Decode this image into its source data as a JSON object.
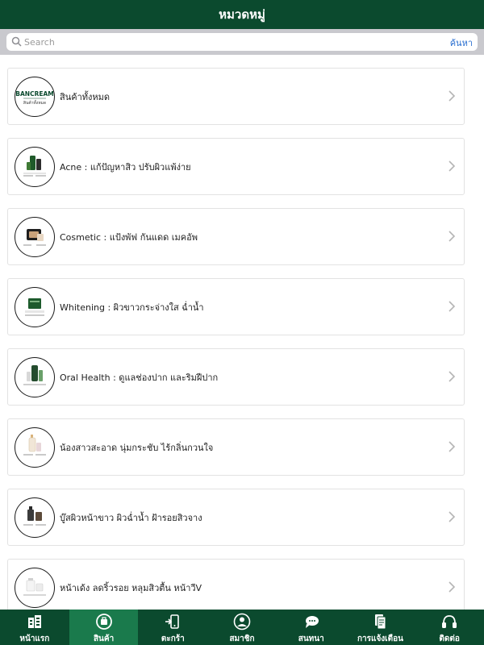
{
  "header": {
    "title": "หมวดหมู่"
  },
  "search": {
    "placeholder": "Search",
    "button_label": "ค้นหา"
  },
  "categories": [
    {
      "label": "สินค้าทั้งหมด",
      "thumb_text": "BANCREAM",
      "thumb_subtext": "สินค้าทั้งหมด",
      "icon": "brand-logo"
    },
    {
      "label": "Acne : แก้ปัญหาสิว ปรับผิวแพ้ง่าย",
      "icon": "acne-products"
    },
    {
      "label": "Cosmetic : แป้งพัฟ กันแดด เมคอัพ",
      "icon": "cosmetic-products"
    },
    {
      "label": "Whitening : ผิวขาวกระจ่างใส ฉ่ำน้ำ",
      "icon": "whitening-products"
    },
    {
      "label": "Oral Health : ดูแลช่องปาก และริมฝีปาก",
      "icon": "oral-health-products"
    },
    {
      "label": "น้องสาวสะอาด นุ่มกระชับ ไร้กลิ่นกวนใจ",
      "icon": "feminine-care-products"
    },
    {
      "label": "บู๊สผิวหน้าขาว ผิวฉ่ำน้ำ ฝ้ารอยสิวจาง",
      "icon": "face-booster-products"
    },
    {
      "label": "หน้าเด้ง ลดริ้วรอย หลุมสิวตื้น หน้าวีV",
      "icon": "anti-aging-products"
    }
  ],
  "tabbar": {
    "items": [
      {
        "label": "หน้าแรก",
        "icon": "home-icon"
      },
      {
        "label": "สินค้า",
        "icon": "products-icon"
      },
      {
        "label": "ตะกร้า",
        "icon": "cart-icon"
      },
      {
        "label": "สมาชิก",
        "icon": "member-icon"
      },
      {
        "label": "สนทนา",
        "icon": "chat-icon"
      },
      {
        "label": "การแจ้งเตือน",
        "icon": "notification-icon"
      },
      {
        "label": "ติดต่อ",
        "icon": "contact-icon"
      }
    ],
    "active_index": 1
  },
  "colors": {
    "brand_green": "#0b4a2e",
    "active_tab": "#1a7a4c",
    "link_blue": "#2a6fd0"
  }
}
